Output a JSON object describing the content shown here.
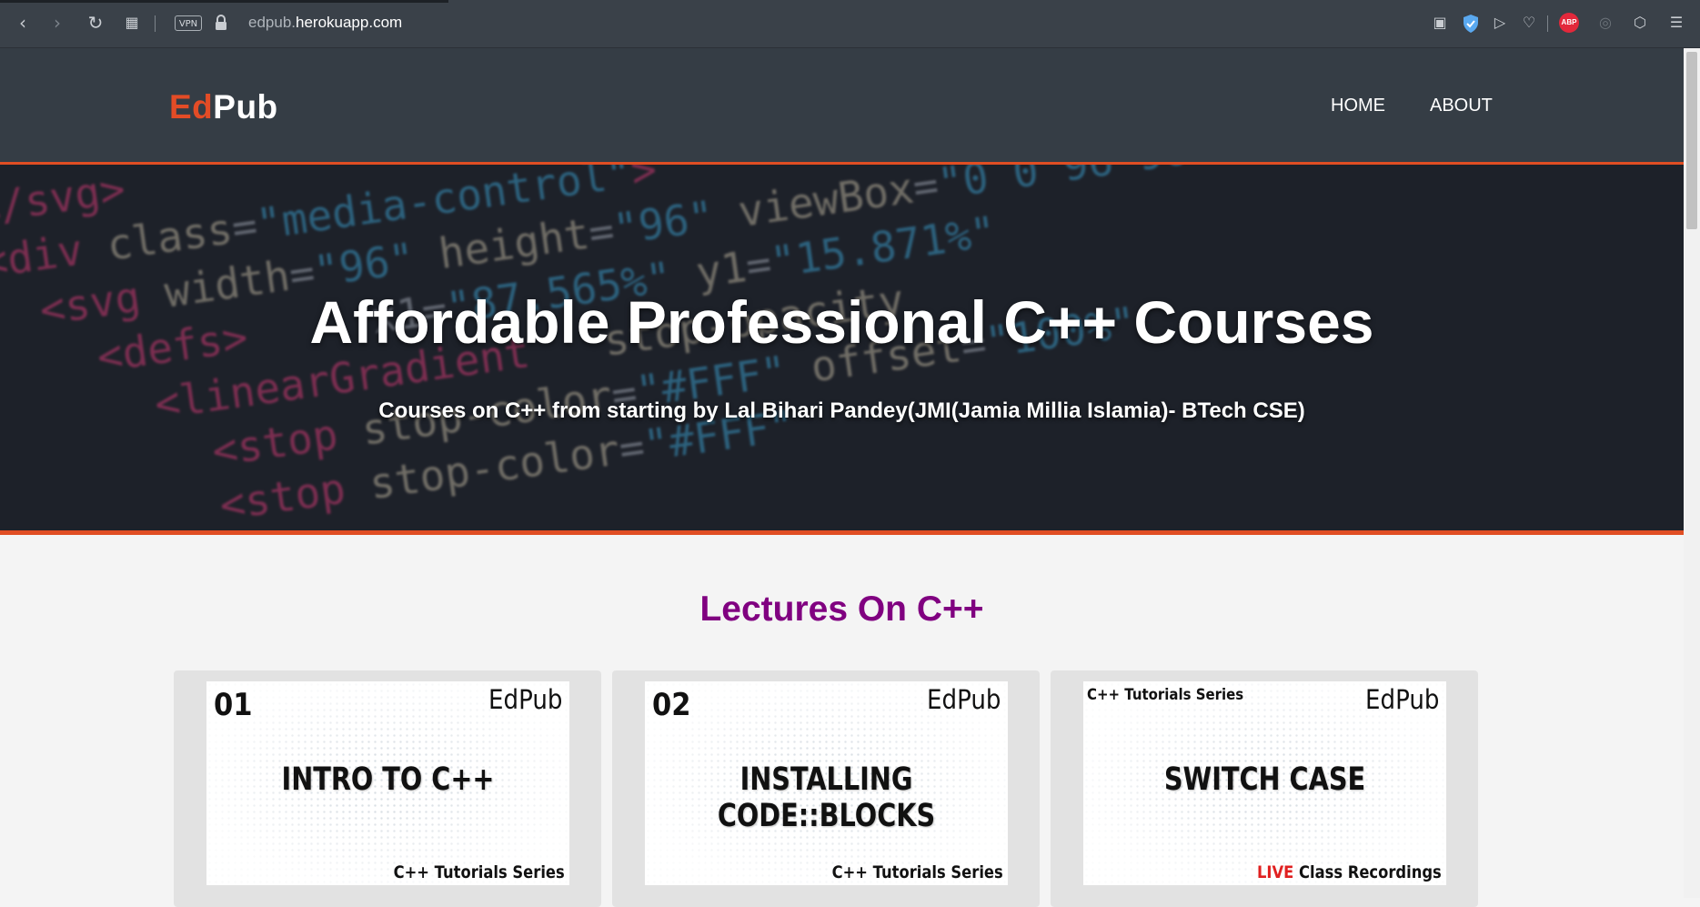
{
  "browser": {
    "url_prefix": "edpub.",
    "url_host": "herokuapp.com",
    "vpn_label": "VPN",
    "abp_label": "ABP",
    "icons": [
      "back-icon",
      "forward-icon",
      "reload-icon",
      "tabs-grid-icon",
      "lock-icon",
      "camera-icon",
      "shield-icon",
      "send-icon",
      "heart-icon",
      "adblock-icon",
      "record-icon",
      "cube-icon",
      "menu-icon"
    ]
  },
  "header": {
    "logo_part1": "Ed",
    "logo_part2": "Pub",
    "nav": [
      {
        "label": "HOME"
      },
      {
        "label": "ABOUT"
      }
    ],
    "accent_color": "#e04e23"
  },
  "hero": {
    "title": "Affordable Professional C++ Courses",
    "subtitle": "Courses on C++ from starting by Lal Bihari Pandey(JMI(Jamia Millia Islamia)- BTech CSE)"
  },
  "lectures": {
    "heading": "Lectures On C++",
    "heading_color": "#800080",
    "cards": [
      {
        "number": "01",
        "brand": "EdPub",
        "title": "INTRO TO C++",
        "footer": "C++ Tutorials Series"
      },
      {
        "number": "02",
        "brand": "EdPub",
        "title": "INSTALLING CODE::BLOCKS",
        "footer": "C++ Tutorials Series"
      },
      {
        "series_top": "C++ Tutorials Series",
        "brand": "EdPub",
        "title": "SWITCH CASE",
        "footer_live": "LIVE",
        "footer_rest": " Class Recordings"
      }
    ]
  }
}
